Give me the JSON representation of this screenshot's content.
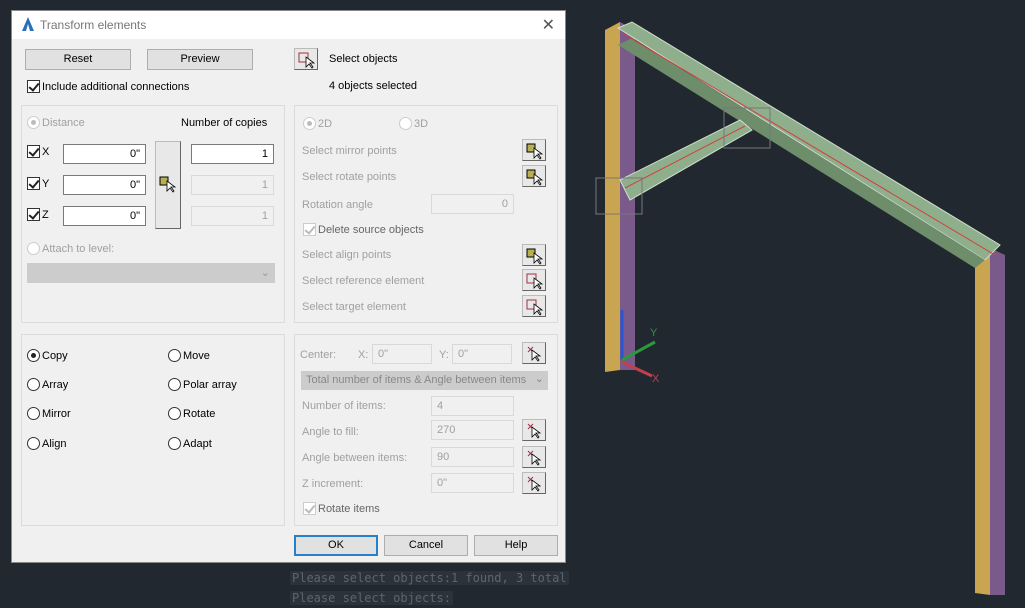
{
  "dialog": {
    "title": "Transform elements",
    "close_icon": "close-icon"
  },
  "top": {
    "reset": "Reset",
    "preview": "Preview",
    "select_objects": "Select objects",
    "objects_selected": "4 objects selected",
    "include_connections": "Include additional connections"
  },
  "distance": {
    "label": "Distance",
    "copies_label": "Number of copies",
    "x_label": "X",
    "y_label": "Y",
    "z_label": "Z",
    "x": "0\"",
    "y": "0\"",
    "z": "0\"",
    "copies_x": "1",
    "copies_y": "1",
    "copies_z": "1",
    "attach_label": "Attach to level:",
    "attach_value": ""
  },
  "mirror": {
    "d2": "2D",
    "d3": "3D",
    "mirror_points": "Select mirror points",
    "rotate_points": "Select rotate points",
    "rotation_angle_label": "Rotation angle",
    "rotation_angle": "0",
    "delete_source": "Delete source objects",
    "align_points": "Select align points",
    "reference_element": "Select reference element",
    "target_element": "Select target element"
  },
  "modes": {
    "copy": "Copy",
    "move": "Move",
    "array": "Array",
    "polar_array": "Polar array",
    "mirror": "Mirror",
    "rotate": "Rotate",
    "align": "Align",
    "adapt": "Adapt",
    "selected": "Copy"
  },
  "polar": {
    "center_label": "Center:",
    "x_label": "X:",
    "y_label": "Y:",
    "cx": "0\"",
    "cy": "0\"",
    "method": "Total number of items & Angle between items",
    "items_label": "Number of items:",
    "items": "4",
    "fill_label": "Angle to fill:",
    "fill": "270",
    "between_label": "Angle between items:",
    "between": "90",
    "z_label": "Z increment:",
    "z": "0\"",
    "rotate_items": "Rotate items"
  },
  "footer": {
    "ok": "OK",
    "cancel": "Cancel",
    "help": "Help"
  },
  "command_line": [
    "Please select objects:1 found, 3 total",
    "Please select objects:"
  ],
  "colors": {
    "background": "#212830",
    "beam": "#8fae8c",
    "column_purple": "#7a5a8a",
    "column_yellow": "#d6b060",
    "accent": "#2a7fc9"
  }
}
